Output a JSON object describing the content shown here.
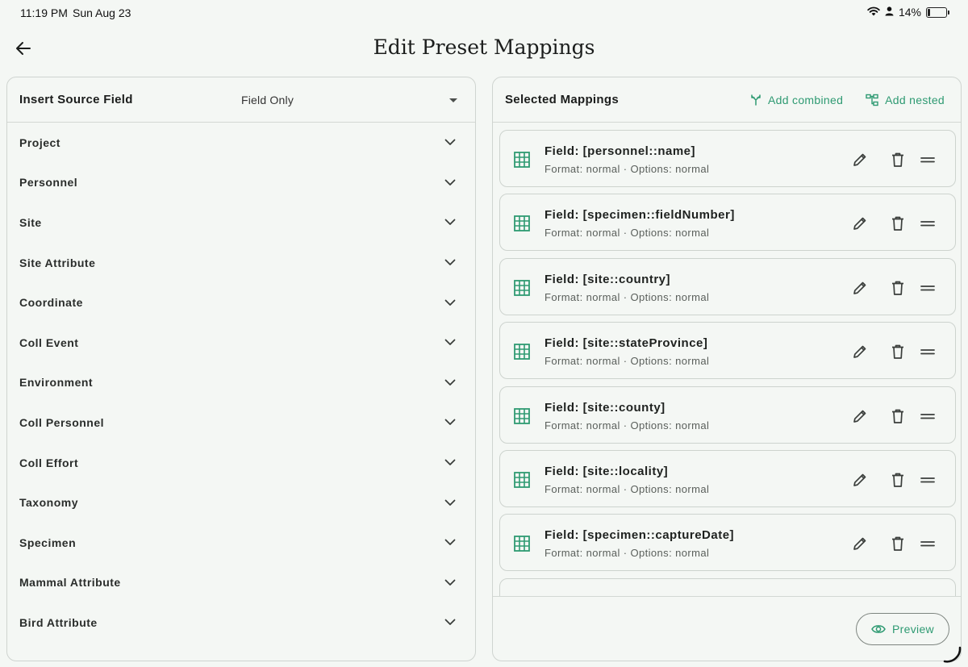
{
  "status_bar": {
    "time": "11:19 PM",
    "date": "Sun Aug 23",
    "battery": "14%",
    "battery_level": 0.14
  },
  "page": {
    "title": "Edit Preset Mappings"
  },
  "left_panel": {
    "title": "Insert Source Field",
    "dropdown_value": "Field Only",
    "categories": [
      "Project",
      "Personnel",
      "Site",
      "Site Attribute",
      "Coordinate",
      "Coll Event",
      "Environment",
      "Coll Personnel",
      "Coll Effort",
      "Taxonomy",
      "Specimen",
      "Mammal Attribute",
      "Bird Attribute"
    ]
  },
  "right_panel": {
    "title": "Selected Mappings",
    "add_combined_label": "Add combined",
    "add_nested_label": "Add nested",
    "mappings": [
      {
        "title": "Field: [personnel::name]",
        "subtitle": "Format: normal · Options: normal"
      },
      {
        "title": "Field: [specimen::fieldNumber]",
        "subtitle": "Format: normal · Options: normal"
      },
      {
        "title": "Field: [site::country]",
        "subtitle": "Format: normal · Options: normal"
      },
      {
        "title": "Field: [site::stateProvince]",
        "subtitle": "Format: normal · Options: normal"
      },
      {
        "title": "Field: [site::county]",
        "subtitle": "Format: normal · Options: normal"
      },
      {
        "title": "Field: [site::locality]",
        "subtitle": "Format: normal · Options: normal"
      },
      {
        "title": "Field: [specimen::captureDate]",
        "subtitle": "Format: normal · Options: normal"
      }
    ],
    "preview_label": "Preview"
  },
  "colors": {
    "accent": "#2e9a72",
    "background": "#f4f7f4",
    "border": "#cfd4d0"
  }
}
